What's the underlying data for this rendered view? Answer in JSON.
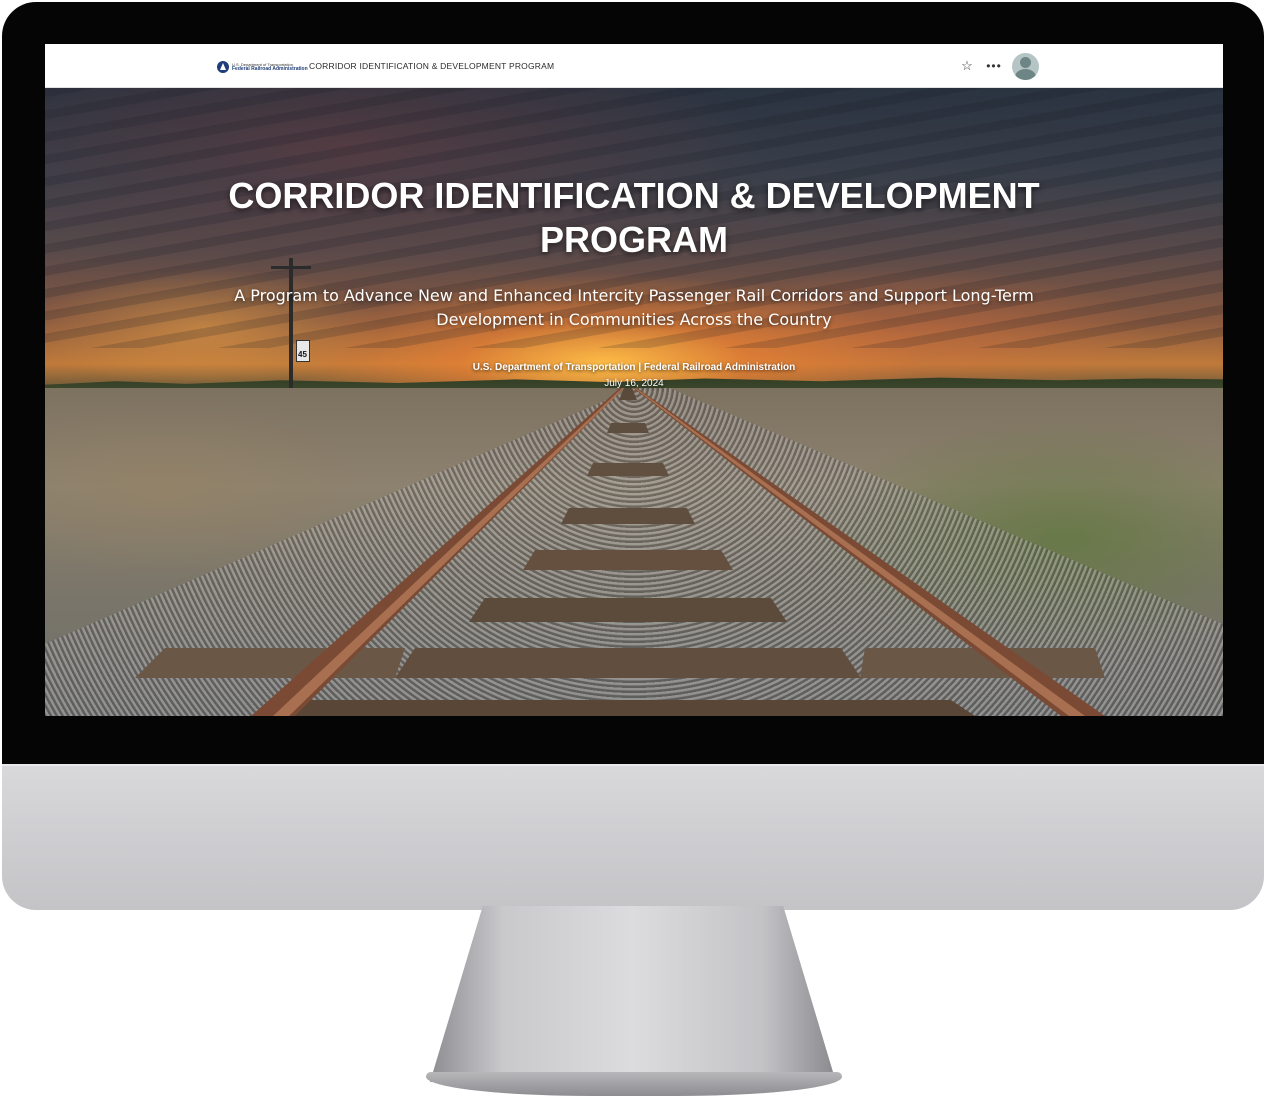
{
  "topbar": {
    "logo_line1": "U.S. Department of Transportation",
    "logo_line2": "Federal Railroad Administration",
    "title": "CORRIDOR IDENTIFICATION & DEVELOPMENT PROGRAM",
    "icons": [
      "star-icon",
      "more-icon",
      "avatar"
    ]
  },
  "hero": {
    "title": "CORRIDOR IDENTIFICATION & DEVELOPMENT PROGRAM",
    "subtitle": "A Program to Advance New and Enhanced Intercity Passenger Rail Corridors and Support Long-Term Development in Communities Across the Country",
    "agency": "U.S. Department of Transportation | Federal Railroad Administration",
    "date": "July 16, 2024"
  },
  "colors": {
    "brand": "#1f3d7a",
    "topbar_bg": "#ffffff",
    "hero_text": "#ffffff"
  }
}
